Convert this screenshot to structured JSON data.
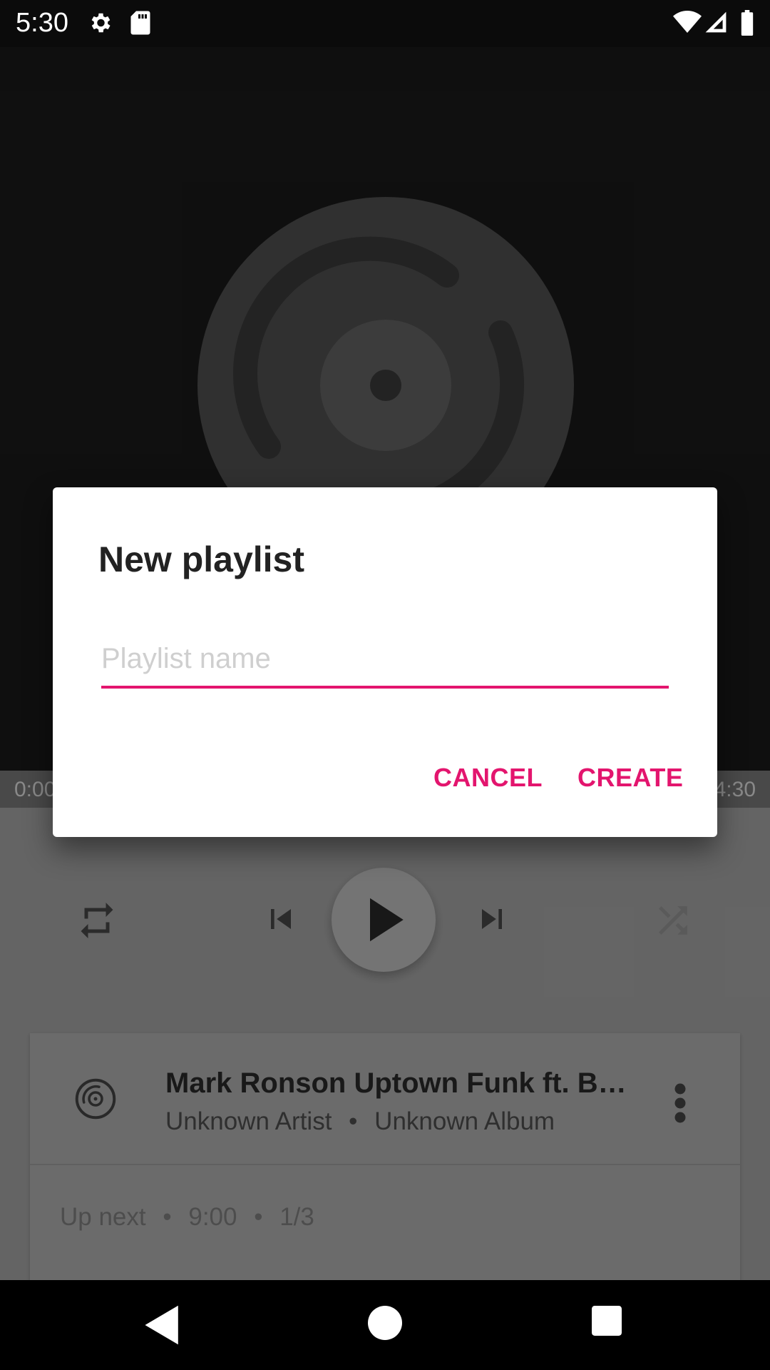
{
  "status_bar": {
    "time": "5:30",
    "icons": [
      "gear-icon",
      "sd-card-icon",
      "wifi-icon",
      "cell-signal-icon",
      "battery-icon"
    ]
  },
  "player": {
    "elapsed": "0:00",
    "duration": "4:30",
    "art_icon": "disc-icon",
    "controls": [
      "repeat-icon",
      "skip-previous-icon",
      "play-icon",
      "skip-next-icon",
      "shuffle-icon"
    ]
  },
  "queue": {
    "current_track": {
      "title": "Mark Ronson  Uptown Funk ft. B…",
      "artist": "Unknown Artist",
      "album": "Unknown Album",
      "separator": "•"
    },
    "up_next": {
      "label": "Up next",
      "total_time": "9:00",
      "position": "1/3",
      "separator": "•"
    }
  },
  "dialog": {
    "title": "New playlist",
    "input_value": "",
    "input_placeholder": "Playlist name",
    "cancel_label": "CANCEL",
    "create_label": "CREATE"
  },
  "nav_bar": {
    "buttons": [
      "back-icon",
      "home-icon",
      "recents-icon"
    ]
  },
  "colors": {
    "accent": "#e3156e",
    "dialog_bg": "#ffffff",
    "status_bar": "#0b0b0b"
  }
}
